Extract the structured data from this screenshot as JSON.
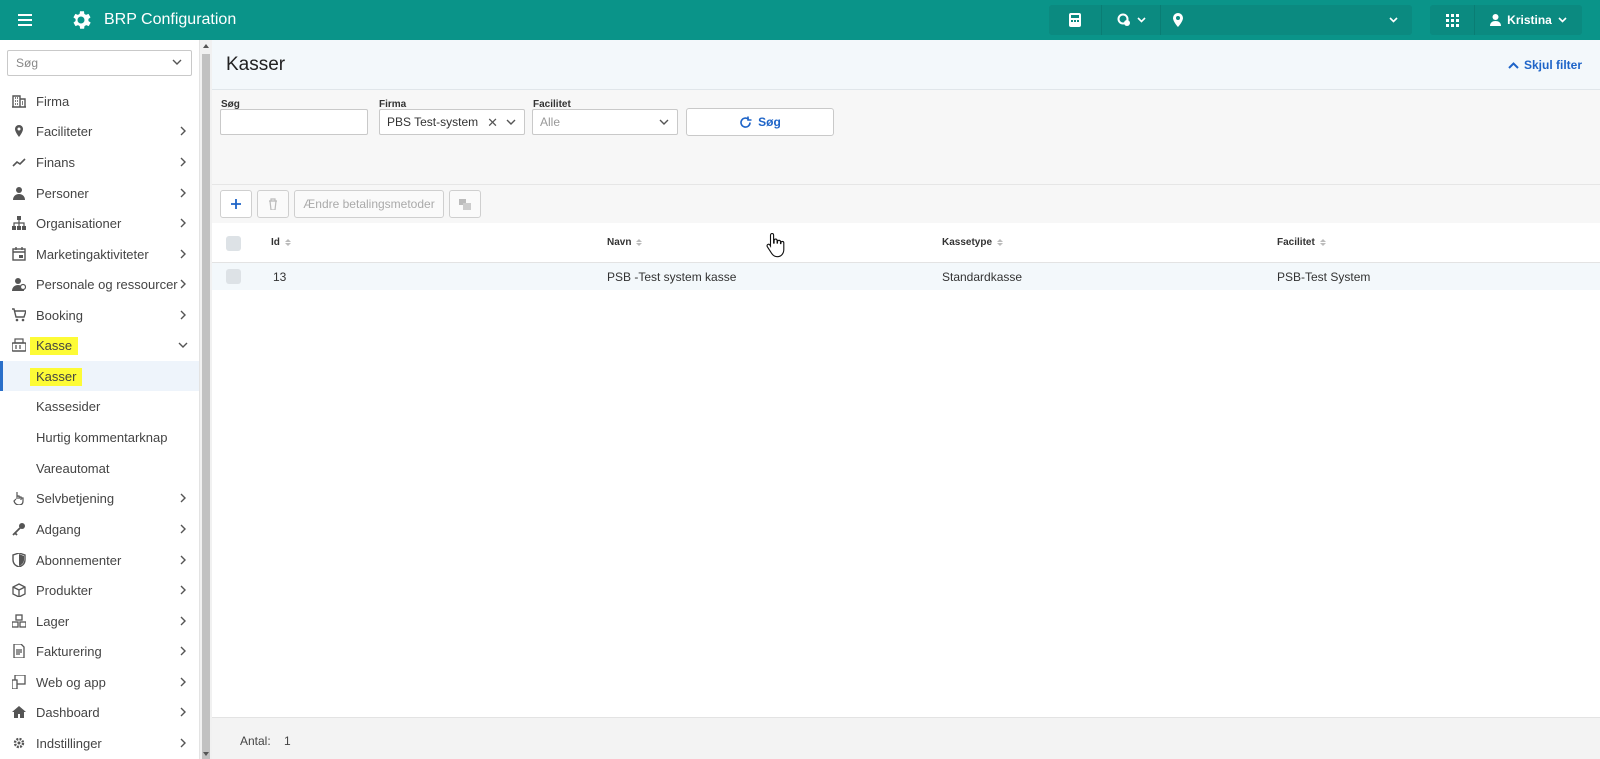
{
  "app": {
    "title": "BRP Configuration",
    "user_name": "Kristina"
  },
  "colors": {
    "brand": "#0a9489",
    "highlight": "#fdfb36",
    "link": "#1e64c8"
  },
  "sidebar": {
    "search_placeholder": "Søg",
    "items": [
      {
        "label": "Firma",
        "icon": "building-icon",
        "has_arrow": false
      },
      {
        "label": "Faciliteter",
        "icon": "map-pin-icon",
        "has_arrow": true
      },
      {
        "label": "Finans",
        "icon": "trend-line-icon",
        "has_arrow": true
      },
      {
        "label": "Personer",
        "icon": "person-icon",
        "has_arrow": true
      },
      {
        "label": "Organisationer",
        "icon": "org-chart-icon",
        "has_arrow": true
      },
      {
        "label": "Marketingaktiviteter",
        "icon": "calendar-icon",
        "has_arrow": true
      },
      {
        "label": "Personale og ressourcer",
        "icon": "staff-icon",
        "has_arrow": true
      },
      {
        "label": "Booking",
        "icon": "cart-icon",
        "has_arrow": true
      },
      {
        "label": "Kasse",
        "icon": "cash-register-icon",
        "expanded": true
      },
      {
        "label": "Selvbetjening",
        "icon": "hand-icon",
        "has_arrow": true
      },
      {
        "label": "Adgang",
        "icon": "key-icon",
        "has_arrow": true
      },
      {
        "label": "Abonnementer",
        "icon": "shield-icon",
        "has_arrow": true
      },
      {
        "label": "Produkter",
        "icon": "box-icon",
        "has_arrow": true
      },
      {
        "label": "Lager",
        "icon": "boxes-icon",
        "has_arrow": true
      },
      {
        "label": "Fakturering",
        "icon": "invoice-icon",
        "has_arrow": true
      },
      {
        "label": "Web og app",
        "icon": "devices-icon",
        "has_arrow": true
      },
      {
        "label": "Dashboard",
        "icon": "home-icon",
        "has_arrow": true
      },
      {
        "label": "Indstillinger",
        "icon": "gear-icon",
        "has_arrow": true
      }
    ],
    "kasse_sub": [
      {
        "label": "Kasser",
        "active": true
      },
      {
        "label": "Kassesider"
      },
      {
        "label": "Hurtig kommentarknap"
      },
      {
        "label": "Vareautomat"
      }
    ]
  },
  "page": {
    "title": "Kasser",
    "hide_filter": "Skjul filter",
    "filters": {
      "search_label": "Søg",
      "search_value": "",
      "firma_label": "Firma",
      "firma_value": "PBS Test-system",
      "facilitet_label": "Facilitet",
      "facilitet_placeholder": "Alle",
      "search_button": "Søg"
    },
    "toolbar": {
      "change_payment_methods": "Ændre betalingsmetoder"
    },
    "table": {
      "columns": [
        "Id",
        "Navn",
        "Kassetype",
        "Facilitet"
      ],
      "rows": [
        [
          "13",
          "PSB -Test system kasse",
          "Standardkasse",
          "PSB-Test System"
        ]
      ]
    },
    "footer": {
      "count_label": "Antal:",
      "count_value": "1"
    }
  }
}
